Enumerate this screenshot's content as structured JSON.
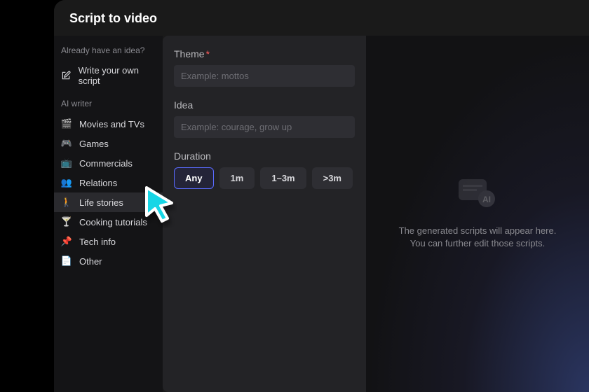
{
  "title": "Script to video",
  "sidebar": {
    "idea_prompt": "Already have an idea?",
    "write_own": "Write your own script",
    "ai_writer_label": "AI writer",
    "items": [
      {
        "icon": "🎬",
        "label": "Movies and TVs"
      },
      {
        "icon": "🎮",
        "label": "Games"
      },
      {
        "icon": "📺",
        "label": "Commercials"
      },
      {
        "icon": "👥",
        "label": "Relations"
      },
      {
        "icon": "🚶",
        "label": "Life stories"
      },
      {
        "icon": "🍸",
        "label": "Cooking tutorials"
      },
      {
        "icon": "📌",
        "label": "Tech info"
      },
      {
        "icon": "📄",
        "label": "Other"
      }
    ]
  },
  "form": {
    "theme_label": "Theme",
    "theme_placeholder": "Example: mottos",
    "idea_label": "Idea",
    "idea_placeholder": "Example: courage, grow up",
    "duration_label": "Duration",
    "durations": [
      "Any",
      "1m",
      "1–3m",
      ">3m"
    ],
    "duration_selected": "Any"
  },
  "right": {
    "placeholder": "The generated scripts will appear here. You can further edit those scripts."
  },
  "colors": {
    "accent": "#5a6bff",
    "cursor": "#18d6e6"
  }
}
